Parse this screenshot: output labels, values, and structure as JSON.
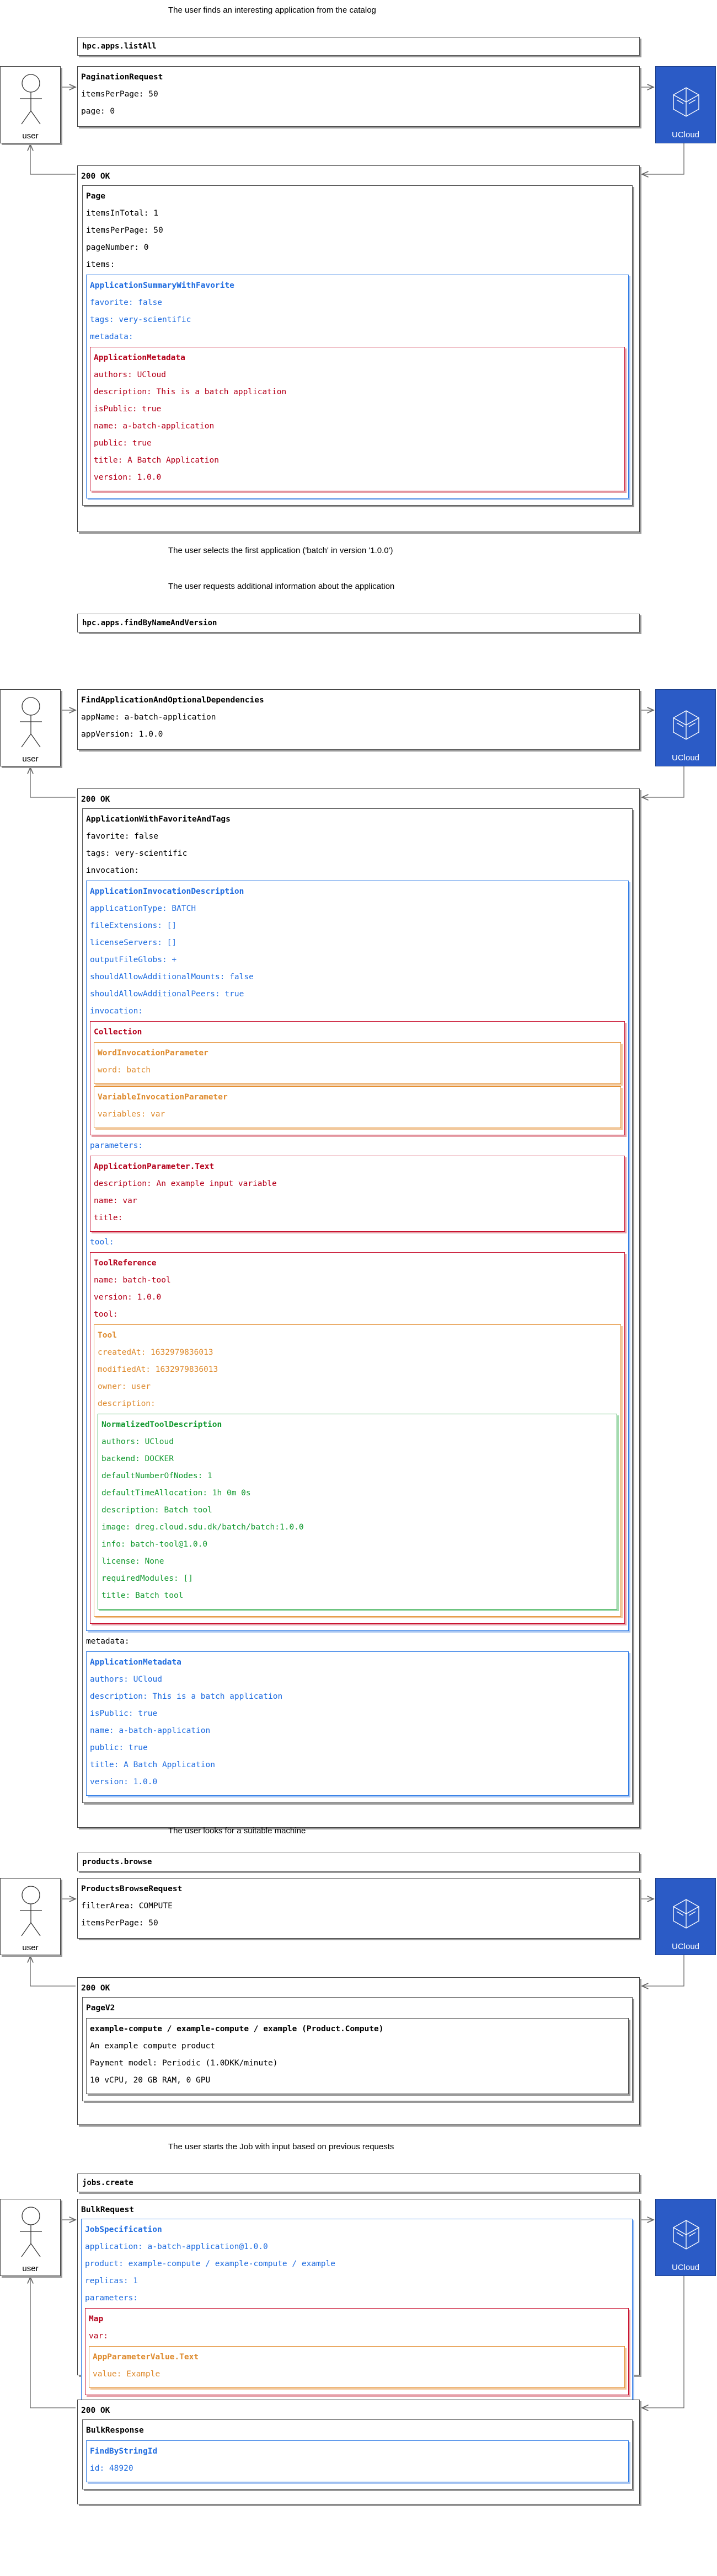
{
  "actor_label": "user",
  "service_label": "UCloud",
  "steps": [
    {
      "caption": "The user finds an interesting application from the catalog",
      "call": "hpc.apps.listAll",
      "request": {
        "title": "PaginationRequest",
        "lines": [
          "itemsPerPage: 50",
          "page: 0"
        ]
      },
      "response_status": "200 OK",
      "after_caption": "The user selects the first application ('batch' in version '1.0.0')"
    },
    {
      "caption": "The user requests additional information about the application",
      "call": "hpc.apps.findByNameAndVersion",
      "request": {
        "title": "FindApplicationAndOptionalDependencies",
        "lines": [
          "appName: a-batch-application",
          "appVersion: 1.0.0"
        ]
      },
      "response_status": "200 OK",
      "after_caption": "The user looks for a suitable machine"
    },
    {
      "caption": "",
      "call": "products.browse",
      "request": {
        "title": "ProductsBrowseRequest",
        "lines": [
          "filterArea: COMPUTE",
          "itemsPerPage: 50"
        ]
      },
      "response_status": "200 OK"
    },
    {
      "caption": "The user starts the Job with input based on previous requests",
      "call": "jobs.create",
      "response_status": "200 OK"
    }
  ],
  "r1": {
    "page_title": "Page",
    "page_lines": [
      "itemsInTotal: 1",
      "itemsPerPage: 50",
      "pageNumber: 0",
      "items:"
    ],
    "summary_title": "ApplicationSummaryWithFavorite",
    "summary_lines": [
      "favorite: false",
      "tags: very-scientific",
      "metadata:"
    ],
    "meta_title": "ApplicationMetadata",
    "meta_lines": [
      "authors: UCloud",
      "description: This is a batch application",
      "isPublic: true",
      "name: a-batch-application",
      "public: true",
      "title: A Batch Application",
      "version: 1.0.0"
    ]
  },
  "r2": {
    "root_title": "ApplicationWithFavoriteAndTags",
    "root_lines": [
      "favorite: false",
      "tags: very-scientific",
      "invocation:"
    ],
    "inv_title": "ApplicationInvocationDescription",
    "inv_lines": [
      "applicationType: BATCH",
      "fileExtensions: []",
      "licenseServers: []",
      "outputFileGlobs: +",
      "shouldAllowAdditionalMounts: false",
      "shouldAllowAdditionalPeers: true",
      "invocation:"
    ],
    "coll_title": "Collection",
    "word_title": "WordInvocationParameter",
    "word_lines": [
      "word: batch"
    ],
    "var_title": "VariableInvocationParameter",
    "var_lines": [
      "variables: var"
    ],
    "params_label": "parameters:",
    "param_title": "ApplicationParameter.Text",
    "param_lines": [
      "description: An example input variable",
      "name: var",
      "title:"
    ],
    "tool_label": "tool:",
    "toolref_title": "ToolReference",
    "toolref_lines": [
      "name: batch-tool",
      "version: 1.0.0",
      "tool:"
    ],
    "tool_title": "Tool",
    "tool_lines": [
      "createdAt: 1632979836013",
      "modifiedAt: 1632979836013",
      "owner: user",
      "description:"
    ],
    "ntd_title": "NormalizedToolDescription",
    "ntd_lines": [
      "authors: UCloud",
      "backend: DOCKER",
      "defaultNumberOfNodes: 1",
      "defaultTimeAllocation: 1h 0m 0s",
      "description: Batch tool",
      "image: dreg.cloud.sdu.dk/batch/batch:1.0.0",
      "info: batch-tool@1.0.0",
      "license: None",
      "requiredModules: []",
      "title: Batch tool"
    ],
    "metadata_label": "metadata:",
    "meta_title": "ApplicationMetadata",
    "meta_lines": [
      "authors: UCloud",
      "description: This is a batch application",
      "isPublic: true",
      "name: a-batch-application",
      "public: true",
      "title: A Batch Application",
      "version: 1.0.0"
    ]
  },
  "r3": {
    "page_title": "PageV2",
    "item_title": "example-compute / example-compute / example (Product.Compute)",
    "item_lines": [
      "An example compute product",
      "Payment model: Periodic (1.0DKK/minute)",
      "10 vCPU, 20 GB RAM, 0 GPU"
    ]
  },
  "r4req": {
    "title": "BulkRequest",
    "spec_title": "JobSpecification",
    "spec_lines": [
      "application: a-batch-application@1.0.0",
      "product: example-compute / example-compute / example",
      "replicas: 1",
      "parameters:"
    ],
    "map_title": "Map",
    "map_lines": [
      "var:"
    ],
    "apv_title": "AppParameterValue.Text",
    "apv_lines": [
      "value: Example"
    ]
  },
  "r4resp": {
    "title": "BulkResponse",
    "id_title": "FindByStringId",
    "id_lines": [
      "id: 48920"
    ]
  },
  "colors": {
    "blue": "#1f6ce0",
    "red": "#b5001a",
    "orange": "#de8a2d",
    "green": "#12992f",
    "cloud": "#2b5bc6"
  }
}
